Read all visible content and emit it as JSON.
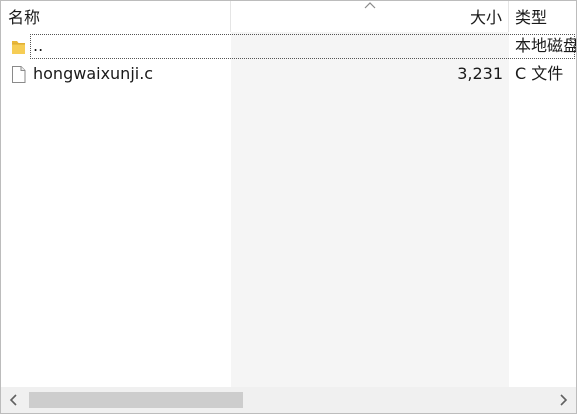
{
  "columns": {
    "name": "名称",
    "size": "大小",
    "type": "类型"
  },
  "sort": {
    "column": "size",
    "icon": "chevron-up-icon"
  },
  "rows": [
    {
      "name": "..",
      "size": "",
      "type": "本地磁盘",
      "icon": "folder-icon",
      "focused": true
    },
    {
      "name": "hongwaixunji.c",
      "size": "3,231",
      "type": "C 文件",
      "icon": "file-icon",
      "focused": false
    }
  ],
  "colors": {
    "folder": "#f3c244",
    "scroll_thumb": "#cdcdcd",
    "sorted_column": "#f5f5f5"
  }
}
